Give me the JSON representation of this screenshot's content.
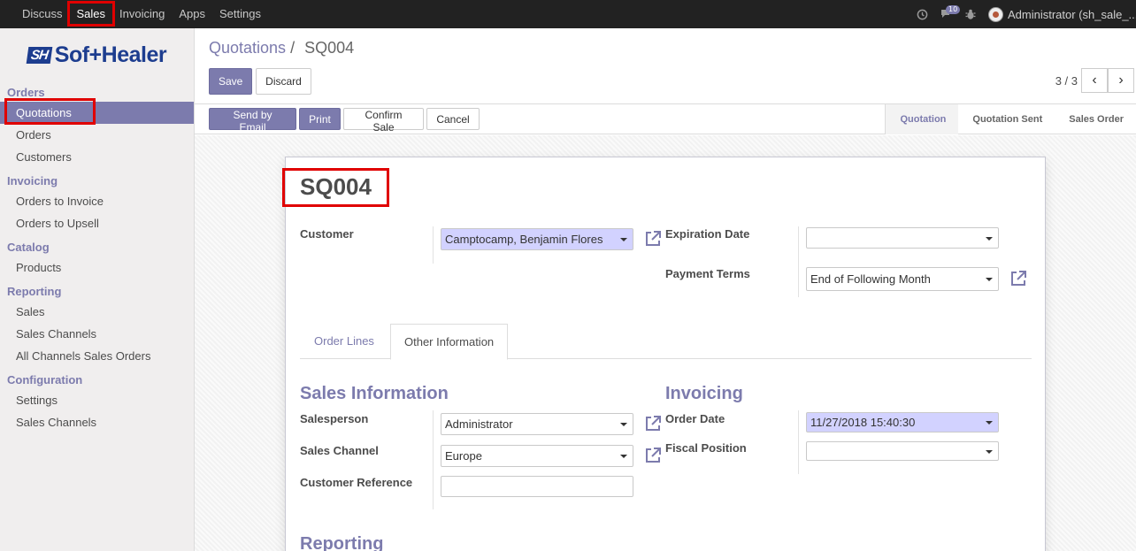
{
  "topbar": {
    "menu": [
      "Discuss",
      "Sales",
      "Invoicing",
      "Apps",
      "Settings"
    ],
    "active": "Sales",
    "messages_count": "10",
    "user": "Administrator (sh_sale_..."
  },
  "sidebar": {
    "logo": {
      "mark": "SH",
      "text": "Sof+Healer"
    },
    "sections": [
      {
        "title": "Orders",
        "items": [
          "Quotations",
          "Orders",
          "Customers"
        ]
      },
      {
        "title": "Invoicing",
        "items": [
          "Orders to Invoice",
          "Orders to Upsell"
        ]
      },
      {
        "title": "Catalog",
        "items": [
          "Products"
        ]
      },
      {
        "title": "Reporting",
        "items": [
          "Sales",
          "Sales Channels",
          "All Channels Sales Orders"
        ]
      },
      {
        "title": "Configuration",
        "items": [
          "Settings",
          "Sales Channels"
        ]
      }
    ],
    "active_item": "Quotations"
  },
  "control_panel": {
    "breadcrumb_parent": "Quotations",
    "breadcrumb_sep": "/",
    "breadcrumb_current": "SQ004",
    "save_label": "Save",
    "discard_label": "Discard",
    "pager": "3 / 3"
  },
  "statusbar": {
    "send_email": "Send by Email",
    "print": "Print",
    "confirm": "Confirm Sale",
    "cancel": "Cancel",
    "stages": [
      "Quotation",
      "Quotation Sent",
      "Sales Order"
    ],
    "active_stage": "Quotation"
  },
  "form": {
    "name": "SQ004",
    "customer_label": "Customer",
    "customer_value": "Camptocamp, Benjamin Flores",
    "expiration_label": "Expiration Date",
    "expiration_value": "",
    "payment_terms_label": "Payment Terms",
    "payment_terms_value": "End of Following Month",
    "tabs": [
      "Order Lines",
      "Other Information"
    ],
    "active_tab": "Other Information",
    "sales_info_title": "Sales Information",
    "salesperson_label": "Salesperson",
    "salesperson_value": "Administrator",
    "sales_channel_label": "Sales Channel",
    "sales_channel_value": "Europe",
    "customer_ref_label": "Customer Reference",
    "customer_ref_value": "",
    "invoicing_title": "Invoicing",
    "order_date_label": "Order Date",
    "order_date_value": "11/27/2018 15:40:30",
    "fiscal_position_label": "Fiscal Position",
    "fiscal_position_value": "",
    "reporting_title": "Reporting"
  }
}
